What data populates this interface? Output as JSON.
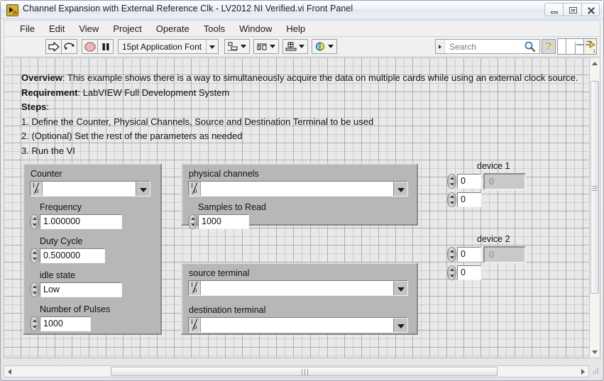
{
  "window": {
    "title": "Channel Expansion with External Reference Clk - LV2012 NI Verified.vi Front Panel",
    "icon_name": "labview-vi-icon",
    "icon_badge": "15",
    "controls": {
      "minimize": "Minimize",
      "restore": "Restore",
      "close": "Close"
    }
  },
  "menubar": {
    "items": [
      {
        "label": "File"
      },
      {
        "label": "Edit"
      },
      {
        "label": "View"
      },
      {
        "label": "Project"
      },
      {
        "label": "Operate"
      },
      {
        "label": "Tools"
      },
      {
        "label": "Window"
      },
      {
        "label": "Help"
      }
    ]
  },
  "toolbar": {
    "run_button": "Run",
    "run_continuously_button": "Run Continuously",
    "abort_button": "Abort Execution",
    "pause_button": "Pause",
    "font_selector": "15pt Application Font",
    "align_button": "Align Objects",
    "distribute_button": "Distribute Objects",
    "resize_button": "Resize Objects",
    "reorder_button": "Reorder",
    "search": {
      "placeholder": "Search"
    },
    "help_button": "?",
    "context_help_panel": "context-help",
    "context_help_number": "1"
  },
  "description": {
    "lines": [
      {
        "bold": "Overview",
        "rest": ": This example shows there is a way to simultaneously acquire the data on multiple cards while using an external clock source."
      },
      {
        "bold": "Requirement",
        "rest": ": LabVIEW Full Development System"
      },
      {
        "bold": "Steps",
        "rest": ":"
      },
      {
        "bold": "",
        "rest": "1. Define the Counter, Physical Channels, Source and Destination Terminal to be used"
      },
      {
        "bold": "",
        "rest": "2. (Optional) Set the rest of the parameters as needed"
      },
      {
        "bold": "",
        "rest": "3. Run the VI"
      }
    ]
  },
  "counter_panel": {
    "counter": {
      "label": "Counter",
      "value": ""
    },
    "frequency": {
      "label": "Frequency",
      "value": "1.000000"
    },
    "duty_cycle": {
      "label": "Duty Cycle",
      "value": "0.500000"
    },
    "idle_state": {
      "label": "idle state",
      "value": "Low"
    },
    "number_of_pulses": {
      "label": "Number of Pulses",
      "value": "1000"
    }
  },
  "channels_panel": {
    "physical_channels": {
      "label": "physical channels",
      "value": ""
    },
    "samples_to_read": {
      "label": "Samples to Read",
      "value": "1000"
    }
  },
  "terminal_panel": {
    "source_terminal": {
      "label": "source terminal",
      "value": ""
    },
    "destination_terminal": {
      "label": "destination terminal",
      "value": ""
    }
  },
  "devices": [
    {
      "label": "device 1",
      "field_a": "0",
      "field_b": "0",
      "indicator": "0"
    },
    {
      "label": "device 2",
      "field_a": "0",
      "field_b": "0",
      "indicator": "0"
    }
  ],
  "scrollbars": {
    "vertical": "vertical-scrollbar",
    "horizontal": "horizontal-scrollbar"
  },
  "colors": {
    "panel_gray": "#b7b7b7",
    "canvas_gray": "#e9e9e9",
    "abort_red": "#e8a0a0",
    "help_yellow": "#c9a227"
  }
}
